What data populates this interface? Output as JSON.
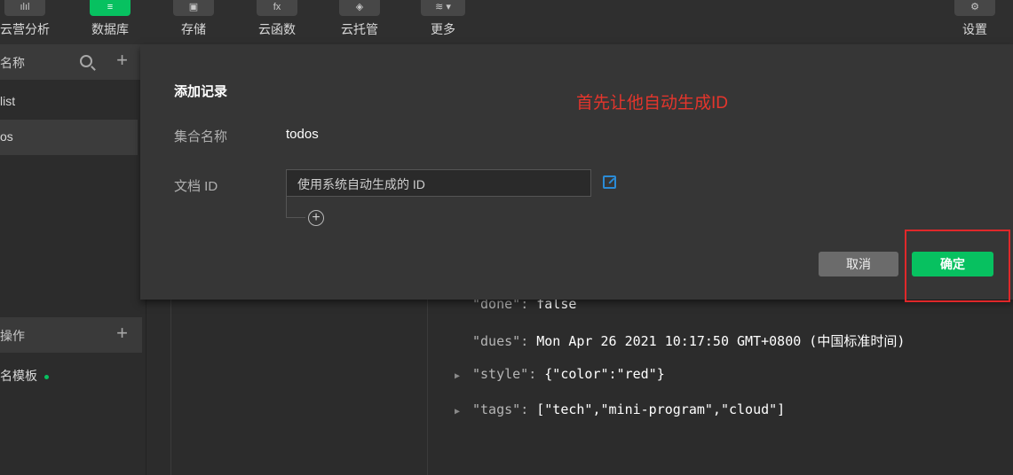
{
  "toolbar": {
    "items": [
      {
        "label": "云营分析",
        "icon": "chart-icon"
      },
      {
        "label": "数据库",
        "icon": "database-icon"
      },
      {
        "label": "存储",
        "icon": "storage-icon"
      },
      {
        "label": "云函数",
        "icon": "function-icon"
      },
      {
        "label": "云托管",
        "icon": "container-icon"
      },
      {
        "label": "更多",
        "icon": "layers-icon"
      }
    ],
    "settings_label": "设置",
    "icon_glyphs": {
      "chart": "ılıl",
      "function": "fx"
    }
  },
  "sidebar": {
    "collections_header": "名称",
    "collections": [
      "list",
      "os"
    ],
    "ops_header": "操作",
    "template": "名模板"
  },
  "document": {
    "fields": [
      {
        "key": "\"done\"",
        "value": "false",
        "expandable": false
      },
      {
        "key": "\"dues\"",
        "value": "Mon Apr 26 2021 10:17:50 GMT+0800 (中国标准时间)",
        "expandable": false
      },
      {
        "key": "\"style\"",
        "value": "{\"color\":\"red\"}",
        "expandable": true
      },
      {
        "key": "\"tags\"",
        "value": "[\"tech\",\"mini-program\",\"cloud\"]",
        "expandable": true
      }
    ]
  },
  "modal": {
    "title": "添加记录",
    "collection_label": "集合名称",
    "collection_value": "todos",
    "doc_id_label": "文档 ID",
    "doc_id_placeholder": "使用系统自动生成的 ID",
    "annotation": "首先让他自动生成ID",
    "cancel_label": "取消",
    "confirm_label": "确定"
  },
  "colors": {
    "accent": "#07c160",
    "annotation": "#e5352c",
    "link": "#2a8bd6"
  }
}
